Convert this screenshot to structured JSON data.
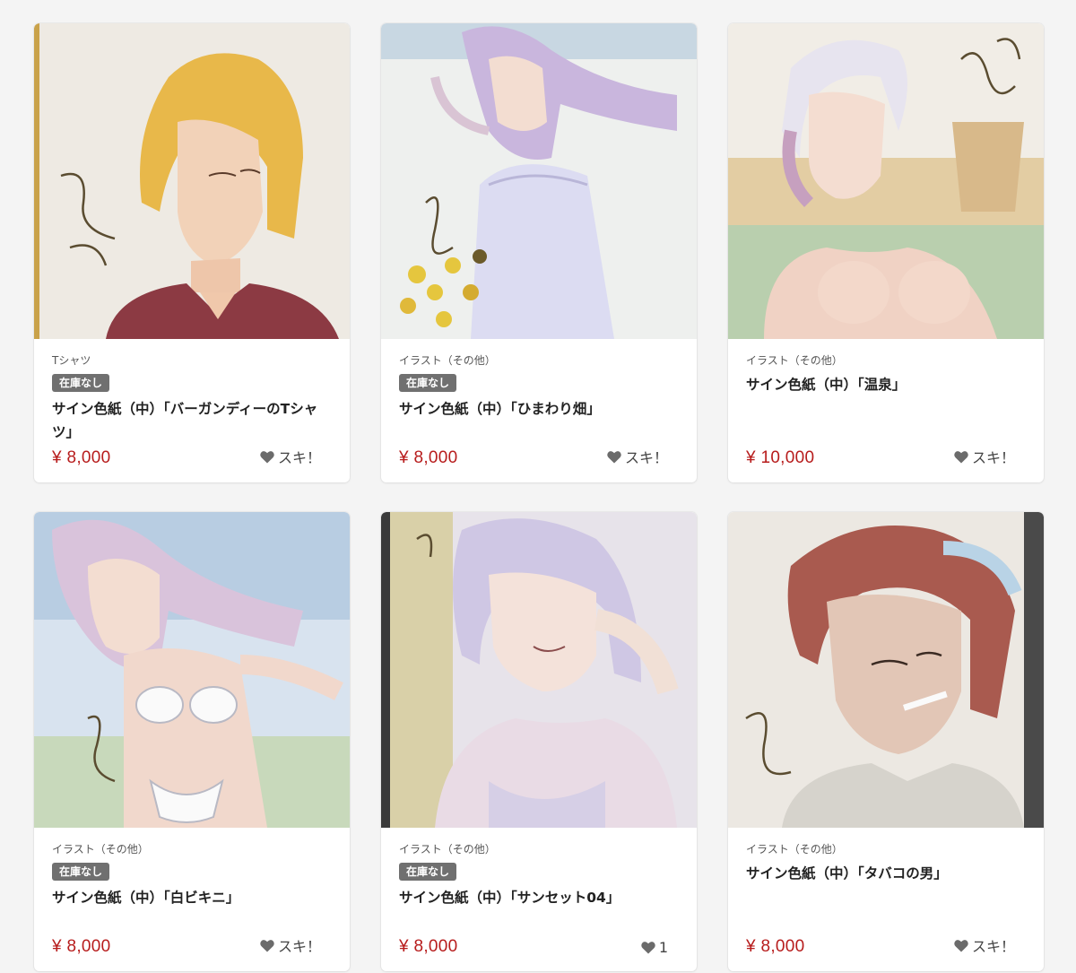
{
  "items": [
    {
      "category": "Tシャツ",
      "badge": "在庫なし",
      "title": "サイン色紙（中）「バーガンディーのTシャツ」",
      "price": "¥ 8,000",
      "like_label": "スキ！",
      "image_icon": "illustration-blonde-man-burgundy-tshirt"
    },
    {
      "category": "イラスト（その他）",
      "badge": "在庫なし",
      "title": "サイン色紙（中）「ひまわり畑」",
      "price": "¥ 8,000",
      "like_label": "スキ！",
      "image_icon": "illustration-woman-sunflower-field"
    },
    {
      "category": "イラスト（その他）",
      "badge": "",
      "title": "サイン色紙（中）「温泉」",
      "price": "¥ 10,000",
      "like_label": "スキ！",
      "image_icon": "illustration-woman-hot-spring"
    },
    {
      "category": "イラスト（その他）",
      "badge": "在庫なし",
      "title": "サイン色紙（中）「白ビキニ」",
      "price": "¥ 8,000",
      "like_label": "スキ！",
      "image_icon": "illustration-woman-white-bikini"
    },
    {
      "category": "イラスト（その他）",
      "badge": "在庫なし",
      "title": "サイン色紙（中）「サンセット04」",
      "price": "¥ 8,000",
      "like_label": "1",
      "image_icon": "illustration-woman-sunset"
    },
    {
      "category": "イラスト（その他）",
      "badge": "",
      "title": "サイン色紙（中）「タバコの男」",
      "price": "¥ 8,000",
      "like_label": "スキ！",
      "image_icon": "illustration-man-cigarette"
    }
  ],
  "colors": {
    "price": "#b71c1c",
    "badge_bg": "#707070",
    "page_bg": "#f4f4f4",
    "heart": "#6b6b6b"
  }
}
